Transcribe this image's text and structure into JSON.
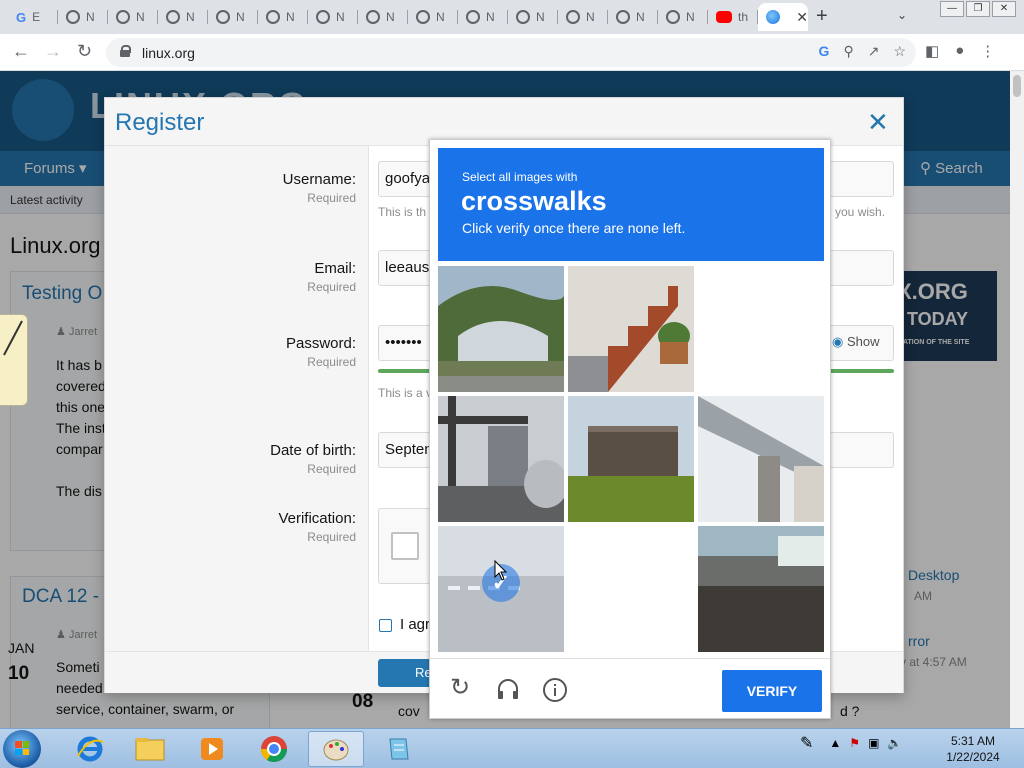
{
  "browser": {
    "tabs": [
      {
        "label": "E",
        "favicon": "google-icon"
      },
      {
        "label": "N",
        "favicon": "tab-icon"
      },
      {
        "label": "N",
        "favicon": "tab-icon"
      },
      {
        "label": "N",
        "favicon": "tab-icon"
      },
      {
        "label": "N",
        "favicon": "tab-icon"
      },
      {
        "label": "N",
        "favicon": "tab-icon"
      },
      {
        "label": "N",
        "favicon": "tab-icon"
      },
      {
        "label": "N",
        "favicon": "tab-icon"
      },
      {
        "label": "N",
        "favicon": "tab-icon"
      },
      {
        "label": "N",
        "favicon": "tab-icon"
      },
      {
        "label": "N",
        "favicon": "tab-icon"
      },
      {
        "label": "N",
        "favicon": "tab-icon"
      },
      {
        "label": "N",
        "favicon": "tab-icon"
      },
      {
        "label": "N",
        "favicon": "tab-icon"
      },
      {
        "label": "th",
        "favicon": "youtube-icon"
      },
      {
        "label": "",
        "favicon": "globe-icon",
        "active": true
      }
    ],
    "url": "linux.org"
  },
  "site": {
    "logo_text": "LINUX.ORG",
    "nav_forums": "Forums",
    "nav_search": "Search",
    "latest_activity": "Latest activity",
    "page_title": "Linux.org",
    "posts": [
      {
        "title": "Testing O",
        "author": "Jarret",
        "date_month": "",
        "date_day": "",
        "text": [
          "It has b",
          "covered",
          "this one",
          "The inst",
          "compar",
          "",
          "The dis"
        ]
      },
      {
        "title": "DCA 12 -",
        "author": "Jarret",
        "date_month": "JAN",
        "date_day": "10",
        "text": [
          "Someti",
          "needed",
          "service, container, swarm, or"
        ]
      }
    ],
    "sidebar": [
      {
        "title": "Desktop",
        "meta": "AM"
      },
      {
        "title": "rror",
        "meta": "y at 4:57 AM"
      }
    ],
    "ad": {
      "line1": "X.ORG",
      "line2": "TODAY",
      "line3": "ATION OF THE SITE"
    },
    "bottom_snippets": [
      "08",
      "cov",
      "d ?"
    ]
  },
  "register": {
    "title": "Register",
    "required_text": "Required",
    "fields": [
      {
        "label": "Username:",
        "value": "goofya",
        "hint": "This is th",
        "hint_right": "e you wish."
      },
      {
        "label": "Email:",
        "value": "leeaus"
      },
      {
        "label": "Password:",
        "value": "•••••••",
        "hint": "This is a v",
        "show_label": "Show"
      },
      {
        "label": "Date of birth:",
        "value": "Septen"
      },
      {
        "label": "Verification:"
      }
    ],
    "agree_text": "I agr",
    "register_button": "Re"
  },
  "captcha": {
    "prompt_small": "Select all images with",
    "prompt_target": "crosswalks",
    "prompt_instruction": "Click verify once there are none left.",
    "verify_button": "VERIFY",
    "tiles": [
      {
        "scene": "hillside-building",
        "selected": false,
        "empty": false
      },
      {
        "scene": "staircase",
        "selected": false,
        "empty": false
      },
      {
        "scene": "",
        "selected": false,
        "empty": true
      },
      {
        "scene": "street-traffic",
        "selected": false,
        "empty": false
      },
      {
        "scene": "wooden-deck",
        "selected": false,
        "empty": false
      },
      {
        "scene": "overpass",
        "selected": false,
        "empty": false
      },
      {
        "scene": "crosswalk-road",
        "selected": true,
        "empty": false
      },
      {
        "scene": "",
        "selected": false,
        "empty": true
      },
      {
        "scene": "shed-roof",
        "selected": false,
        "empty": false
      }
    ]
  },
  "taskbar": {
    "apps": [
      "internet-explorer-icon",
      "file-explorer-icon",
      "media-player-icon",
      "chrome-icon",
      "paint-icon",
      "notepad-icon"
    ],
    "active_app": "paint-icon",
    "time": "5:31 AM",
    "date": "1/22/2024"
  }
}
